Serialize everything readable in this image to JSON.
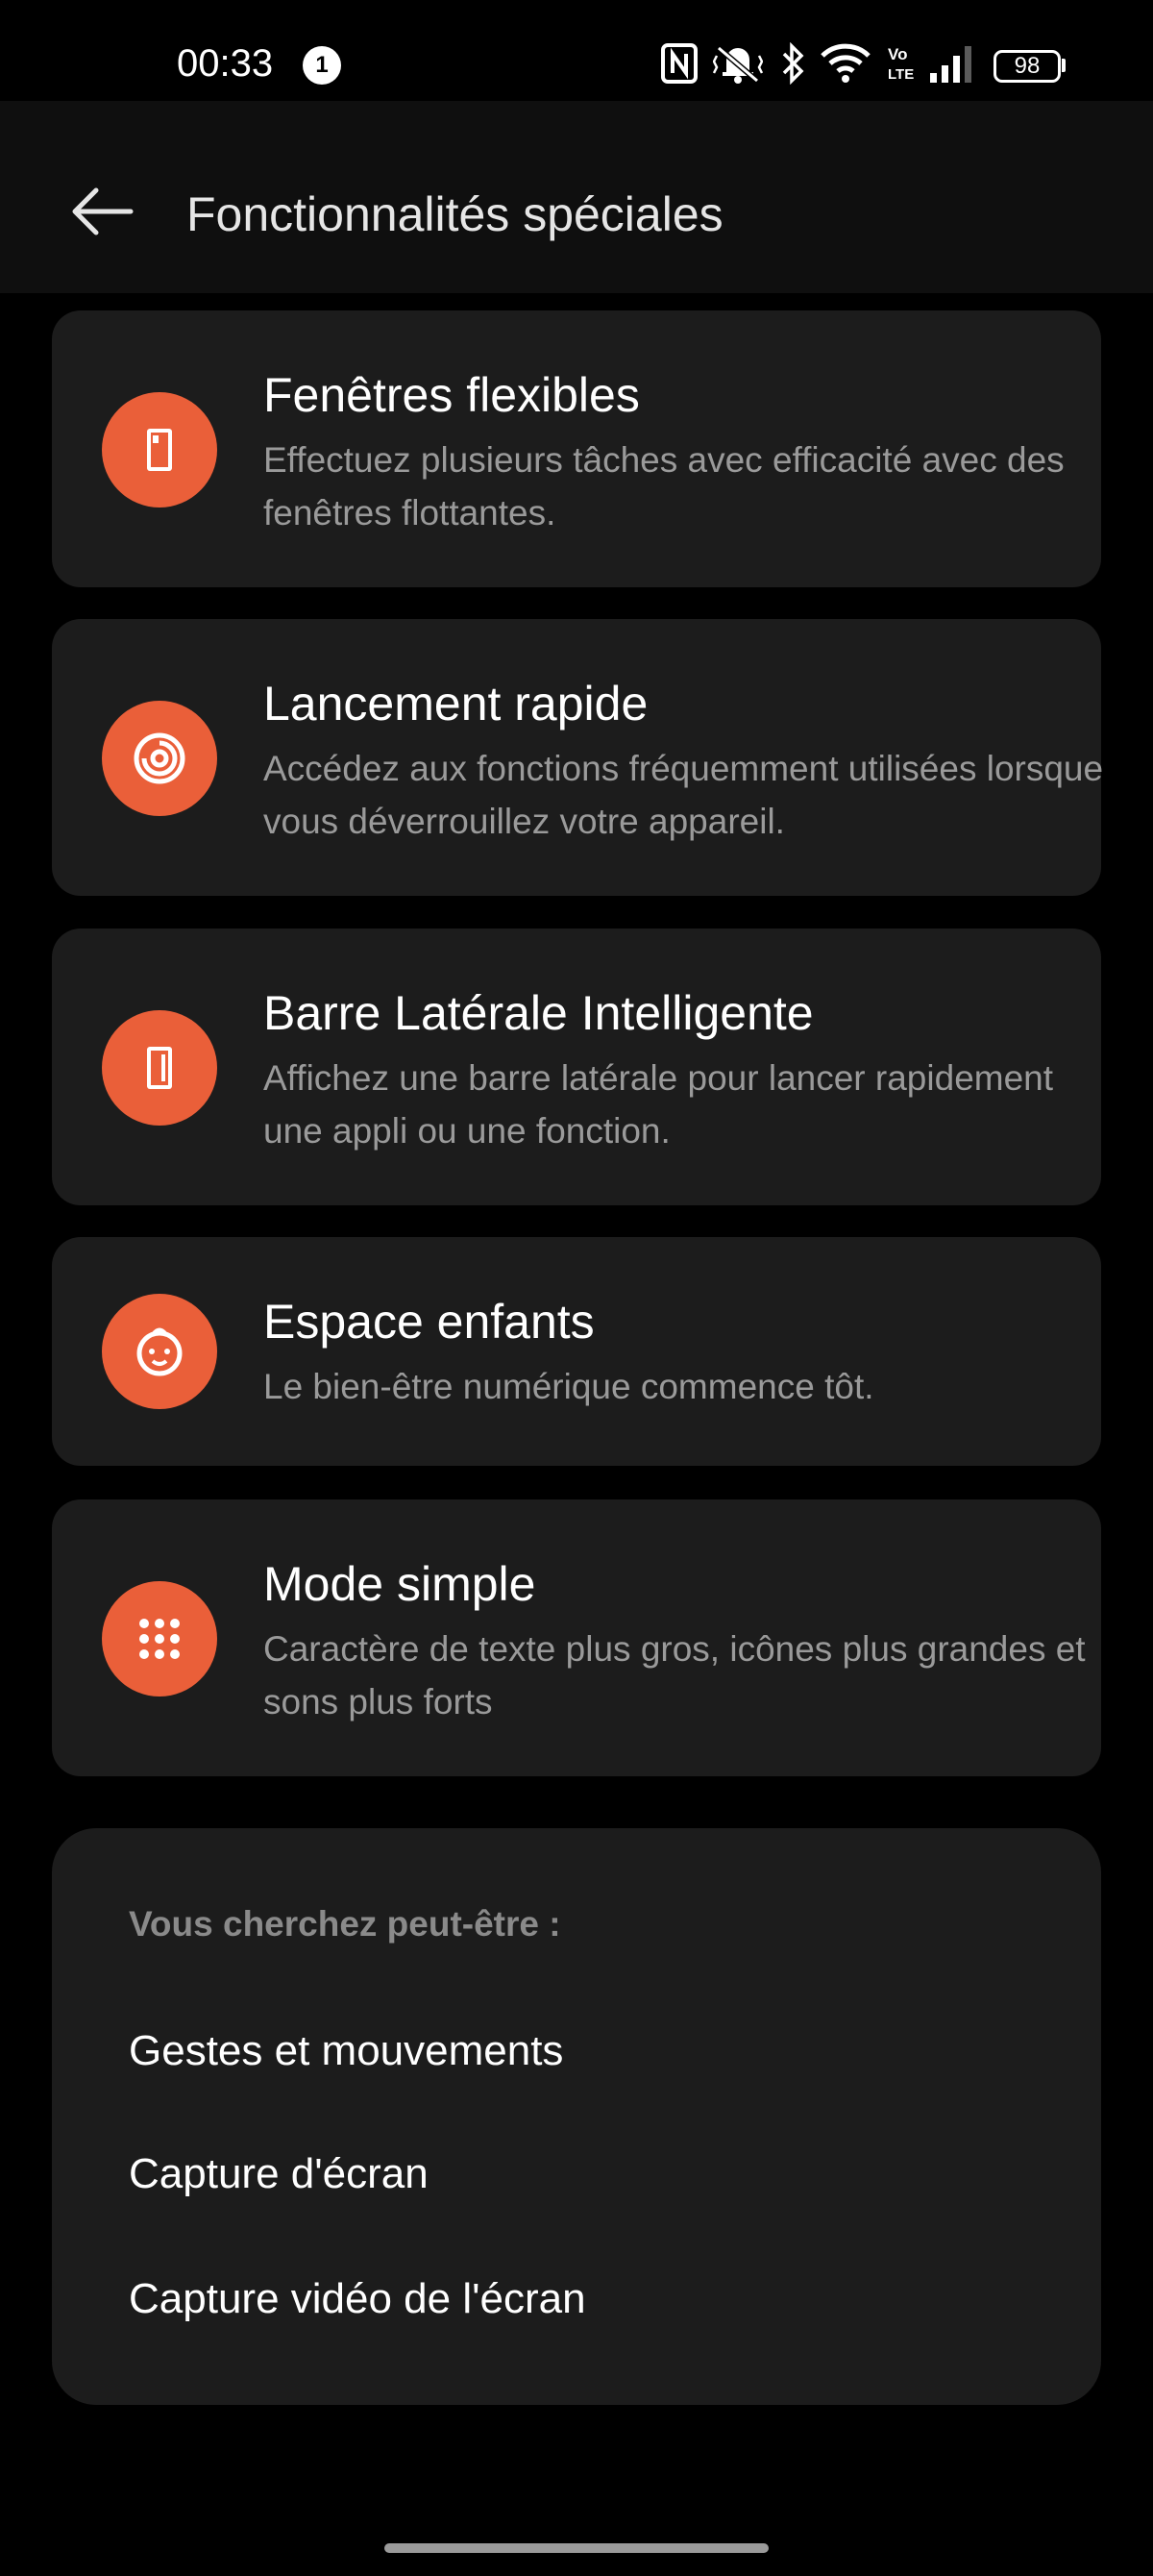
{
  "status_bar": {
    "time": "00:33",
    "notification_count": "1",
    "battery": "98",
    "icons": [
      "nfc-icon",
      "vibrate-mute-icon",
      "bluetooth-icon",
      "wifi-icon",
      "volte-icon",
      "signal-icon",
      "battery-icon"
    ]
  },
  "header": {
    "title": "Fonctionnalités spéciales",
    "back_icon": "arrow-left-icon"
  },
  "features": [
    {
      "title": "Fenêtres flexibles",
      "description": "Effectuez plusieurs tâches avec efficacité avec des fenêtres flottantes.",
      "icon": "floating-window-icon"
    },
    {
      "title": "Lancement rapide",
      "description": "Accédez aux fonctions fréquemment utilisées lorsque vous déverrouillez votre appareil.",
      "icon": "quick-launch-icon"
    },
    {
      "title": "Barre Latérale Intelligente",
      "description": "Affichez une barre latérale pour lancer rapidement une appli ou une fonction.",
      "icon": "sidebar-icon"
    },
    {
      "title": "Espace enfants",
      "description": "Le bien-être numérique commence tôt.",
      "icon": "child-face-icon"
    },
    {
      "title": "Mode simple",
      "description": "Caractère de texte plus gros, icônes plus grandes et sons plus forts",
      "icon": "dots-grid-icon"
    }
  ],
  "suggestions": {
    "header": "Vous cherchez peut-être :",
    "items": [
      "Gestes et mouvements",
      "Capture d'écran",
      "Capture vidéo de l'écran"
    ]
  },
  "colors": {
    "accent": "#ea5f39",
    "card_bg": "#1c1c1c",
    "background": "#000000"
  }
}
